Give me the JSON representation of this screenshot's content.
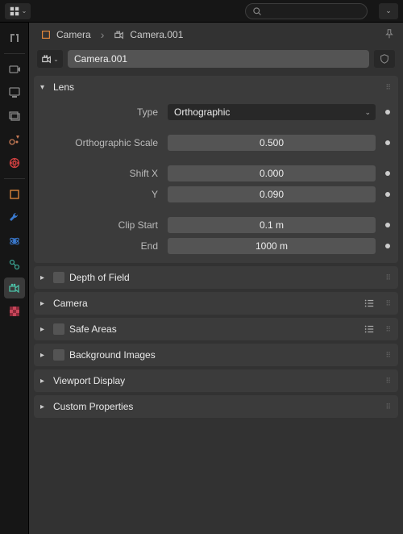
{
  "breadcrumb": {
    "object_label": "Camera",
    "data_label": "Camera.001"
  },
  "name_field": {
    "value": "Camera.001"
  },
  "panels": {
    "lens": {
      "title": "Lens",
      "type_label": "Type",
      "type_value": "Orthographic",
      "ortho_scale_label": "Orthographic Scale",
      "ortho_scale_value": "0.500",
      "shift_x_label": "Shift X",
      "shift_x_value": "0.000",
      "shift_y_label": "Y",
      "shift_y_value": "0.090",
      "clip_start_label": "Clip Start",
      "clip_start_value": "0.1 m",
      "clip_end_label": "End",
      "clip_end_value": "1000 m"
    },
    "depth_of_field": {
      "title": "Depth of Field"
    },
    "camera": {
      "title": "Camera"
    },
    "safe_areas": {
      "title": "Safe Areas"
    },
    "background_images": {
      "title": "Background Images"
    },
    "viewport_display": {
      "title": "Viewport Display"
    },
    "custom_properties": {
      "title": "Custom Properties"
    }
  },
  "tabs": [
    {
      "id": "tool",
      "color": "#8f8f8f"
    },
    {
      "id": "render",
      "color": "#8f8f8f"
    },
    {
      "id": "output",
      "color": "#8f8f8f"
    },
    {
      "id": "view-layer",
      "color": "#8f8f8f"
    },
    {
      "id": "scene",
      "color": "#c77a55"
    },
    {
      "id": "world",
      "color": "#d04040"
    },
    {
      "id": "object",
      "color": "#e88a3c"
    },
    {
      "id": "modifiers",
      "color": "#3a7ad0"
    },
    {
      "id": "physics",
      "color": "#3a7ad0"
    },
    {
      "id": "constraints",
      "color": "#3a9f8f"
    },
    {
      "id": "data-camera",
      "color": "#4cc2a8",
      "active": true
    },
    {
      "id": "texture",
      "color": "#c8465a"
    }
  ]
}
